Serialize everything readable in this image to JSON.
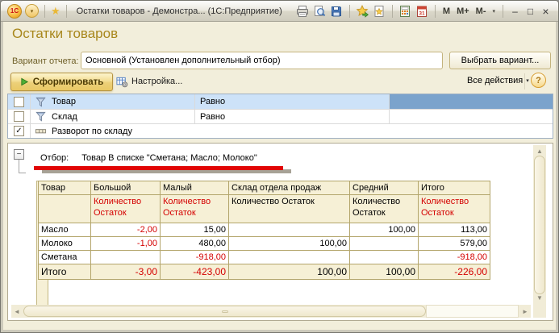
{
  "titlebar": {
    "logo": "1С",
    "title": "Остатки товаров - Демонстра...  (1С:Предприятие)",
    "memory": [
      "M",
      "M+",
      "M-"
    ],
    "window_controls": {
      "minimize": "–",
      "maximize": "□",
      "close": "×"
    }
  },
  "glyphs": {
    "dropdown": "▾",
    "star": "★",
    "up": "▲",
    "down": "▼",
    "left": "◄",
    "right": "►",
    "collapse_minus": "−"
  },
  "page": {
    "title": "Остатки товаров"
  },
  "variant": {
    "label": "Вариант отчета:",
    "value": "Основной (Установлен дополнительный отбор)",
    "choose_button": "Выбрать вариант..."
  },
  "toolbar": {
    "generate_button": "Сформировать",
    "settings_button": "Настройка...",
    "all_actions_button": "Все действия",
    "help_button": "?"
  },
  "filters": {
    "rows": [
      {
        "checked": false,
        "selected": true,
        "icon": "filter-funnel-icon",
        "name": "Товар",
        "condition": "Равно"
      },
      {
        "checked": false,
        "selected": false,
        "icon": "filter-funnel-icon",
        "name": "Склад",
        "condition": "Равно"
      },
      {
        "checked": true,
        "selected": false,
        "icon": "detail-rows-icon",
        "name": "Разворот по складу",
        "condition": ""
      }
    ]
  },
  "report": {
    "filter_label": "Отбор:",
    "filter_text": "Товар В списке \"Сметана; Масло; Молоко\"",
    "table": {
      "qty_label": "Количество Остаток",
      "columns": [
        "Товар",
        "Большой",
        "Малый",
        "Склад отдела продаж",
        "Средний",
        "Итого"
      ],
      "red_subheader_columns": [
        "Большой",
        "Малый",
        "Итого"
      ],
      "rows": [
        {
          "name": "Масло",
          "values": [
            "-2,00",
            "15,00",
            "",
            "100,00",
            "113,00"
          ]
        },
        {
          "name": "Молоко",
          "values": [
            "-1,00",
            "480,00",
            "100,00",
            "",
            "579,00"
          ]
        },
        {
          "name": "Сметана",
          "values": [
            "",
            "-918,00",
            "",
            "",
            "-918,00"
          ]
        }
      ],
      "total_row": {
        "name": "Итого",
        "values": [
          "-3,00",
          "-423,00",
          "100,00",
          "100,00",
          "-226,00"
        ]
      }
    }
  },
  "colors": {
    "negative_red": "#d40000",
    "underline_red": "#e10505",
    "selection_blue": "#cde2f8",
    "selection_dark_blue": "#7ba3cc",
    "header_cream": "#f6f0d6",
    "form_cream": "#f2eedb",
    "page_title_olive": "#a8871c"
  }
}
